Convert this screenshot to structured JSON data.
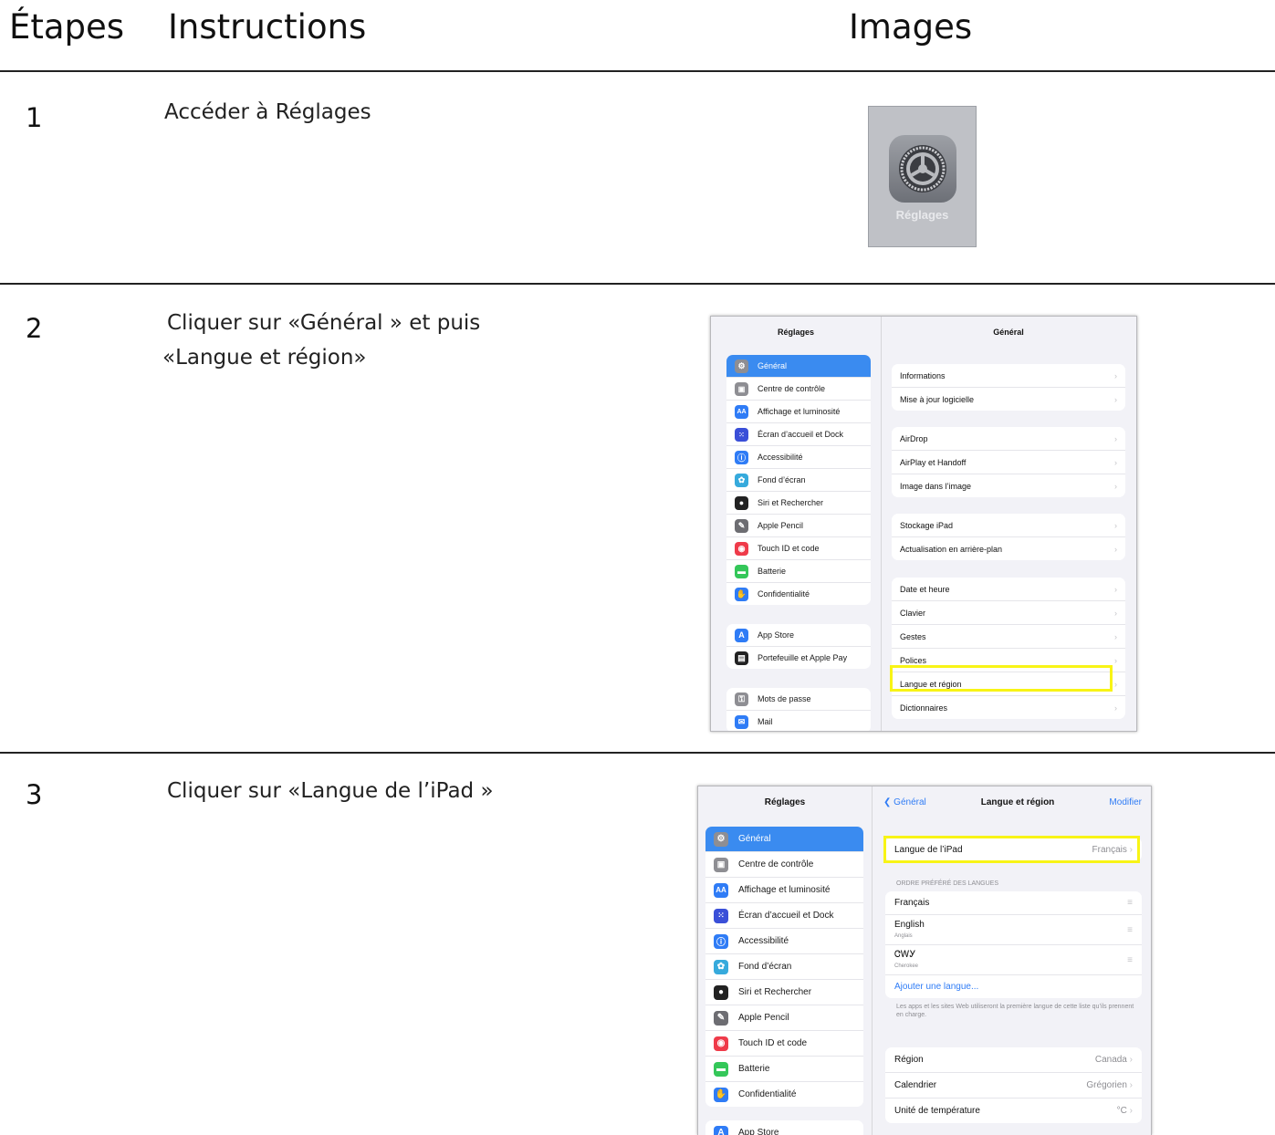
{
  "header": {
    "col_steps": "Étapes",
    "col_instructions": "Instructions",
    "col_images": "Images"
  },
  "steps": [
    {
      "number": "1",
      "instruction": "Accéder à Réglages"
    },
    {
      "number": "2",
      "instruction_line1": "Cliquer sur «Général » et puis",
      "instruction_line2": "«Langue et région»"
    },
    {
      "number": "3",
      "instruction": "Cliquer sur «Langue de l’iPad »"
    }
  ],
  "app_icon": {
    "label": "Réglages",
    "icon": "gear-icon"
  },
  "settings_sidebar": {
    "title": "Réglages",
    "group1": [
      {
        "label": "Général",
        "icon": "gear-icon",
        "color": "#8e8e93"
      },
      {
        "label": "Centre de contrôle",
        "icon": "switches-icon",
        "color": "#8e8e93"
      },
      {
        "label": "Affichage et luminosité",
        "icon": "text-size-icon",
        "color": "#2f7cf6"
      },
      {
        "label": "Écran d’accueil et Dock",
        "icon": "grid-icon",
        "color": "#3a4fd8"
      },
      {
        "label": "Accessibilité",
        "icon": "accessibility-icon",
        "color": "#2f7cf6"
      },
      {
        "label": "Fond d’écran",
        "icon": "flower-icon",
        "color": "#36aadc"
      },
      {
        "label": "Siri et Rechercher",
        "icon": "siri-icon",
        "color": "#222222"
      },
      {
        "label": "Apple Pencil",
        "icon": "pencil-icon",
        "color": "#6d6d72"
      },
      {
        "label": "Touch ID et code",
        "icon": "fingerprint-icon",
        "color": "#ef3b4a"
      },
      {
        "label": "Batterie",
        "icon": "battery-icon",
        "color": "#34c759"
      },
      {
        "label": "Confidentialité",
        "icon": "hand-icon",
        "color": "#2f7cf6"
      }
    ],
    "group2": [
      {
        "label": "App Store",
        "icon": "appstore-icon",
        "color": "#2f7cf6"
      },
      {
        "label": "Portefeuille et Apple Pay",
        "icon": "wallet-icon",
        "color": "#222222"
      }
    ],
    "group3": [
      {
        "label": "Mots de passe",
        "icon": "key-icon",
        "color": "#8e8e93"
      },
      {
        "label": "Mail",
        "icon": "mail-icon",
        "color": "#2f7cf6"
      }
    ]
  },
  "general_panel": {
    "title": "Général",
    "group1": [
      "Informations",
      "Mise à jour logicielle"
    ],
    "group2": [
      "AirDrop",
      "AirPlay et Handoff",
      "Image dans l’image"
    ],
    "group3": [
      "Stockage iPad",
      "Actualisation en arrière-plan"
    ],
    "group4": [
      "Date et heure",
      "Clavier",
      "Gestes",
      "Polices",
      "Langue et région",
      "Dictionnaires"
    ]
  },
  "lang_panel": {
    "back": "Général",
    "title": "Langue et région",
    "edit": "Modifier",
    "ipad_lang_label": "Langue de l’iPad",
    "ipad_lang_value": "Français",
    "section_header": "ORDRE PRÉFÉRÉ DES LANGUES",
    "languages": [
      {
        "name": "Français",
        "sub": ""
      },
      {
        "name": "English",
        "sub": "Anglais"
      },
      {
        "name": "ᏣᎳᎩ",
        "sub": "Cherokee"
      }
    ],
    "add_language": "Ajouter une langue...",
    "footnote": "Les apps et les sites Web utiliseront la première langue de cette liste qu’ils prennent en charge.",
    "region_rows": [
      {
        "label": "Région",
        "value": "Canada"
      },
      {
        "label": "Calendrier",
        "value": "Grégorien"
      },
      {
        "label": "Unité de température",
        "value": "°C"
      }
    ]
  },
  "step3_sidebar_extra": "App Store"
}
